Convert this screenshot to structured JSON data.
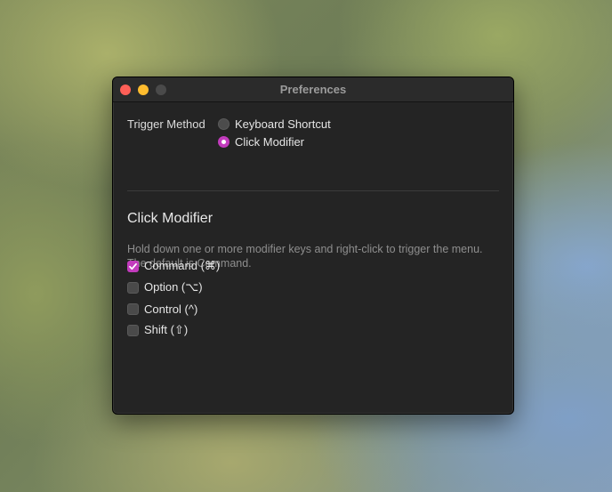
{
  "window": {
    "title": "Preferences"
  },
  "trigger": {
    "label": "Trigger Method",
    "options": [
      {
        "label": "Keyboard Shortcut",
        "selected": false
      },
      {
        "label": "Click Modifier",
        "selected": true
      }
    ]
  },
  "section": {
    "title": "Click Modifier",
    "description": "Hold down one or more modifier keys and right-click to trigger the menu. The default is Command."
  },
  "modifiers": [
    {
      "label": "Command (⌘)",
      "checked": true
    },
    {
      "label": "Option (⌥)",
      "checked": false
    },
    {
      "label": "Control (^)",
      "checked": false
    },
    {
      "label": "Shift (⇧)",
      "checked": false
    }
  ],
  "colors": {
    "accent": "#c23bbd",
    "window_bg": "#242424",
    "close": "#ff5f57",
    "minimize": "#febc2e"
  }
}
